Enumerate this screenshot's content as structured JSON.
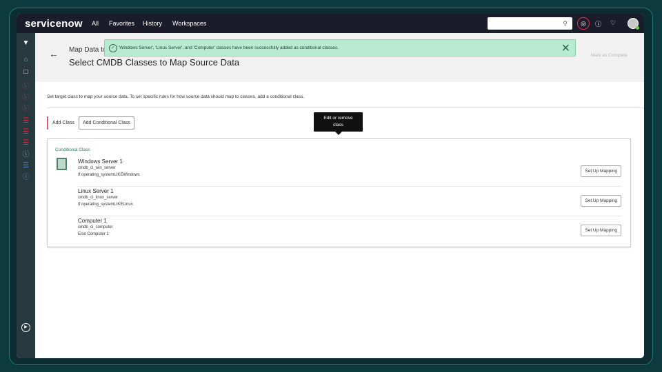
{
  "nav": {
    "logo": "servicenow",
    "items": [
      "All",
      "Favorites",
      "History",
      "Workspaces"
    ],
    "search_placeholder": ""
  },
  "header": {
    "breadcrumb": "Map Data to",
    "title": "Select CMDB Classes to Map Source Data",
    "mark_complete": "Mark as Complete"
  },
  "toast": {
    "message": "'Windows Server', 'Linux Server', and 'Computer' classes have been successfully added as conditional classes."
  },
  "main": {
    "instructions": "Set target class to map your source data. To set specific rules for how source data should map to classes, add a conditional class.",
    "add_class": "Add Class",
    "add_conditional_class": "Add Conditional Class",
    "tooltip_line1": "Edit or remove",
    "tooltip_line2": "class",
    "panel_label": "Conditional Class",
    "setup_label": "Set Up Mapping",
    "rows": [
      {
        "name": "Windows Server 1",
        "table": "cmdb_ci_win_server",
        "condition": "If operating_systemLIKEWindows"
      },
      {
        "name": "Linux Server 1",
        "table": "cmdb_ci_linux_server",
        "condition": "If operating_systemLIKELinux"
      },
      {
        "name": "Computer 1",
        "table": "cmdb_ci_computer",
        "condition": "Else Computer 1"
      }
    ]
  },
  "colors": {
    "nav_bg": "#1b1c2a",
    "sidebar_bg": "#27393c",
    "toast_bg": "#b9ebd3",
    "accent_green": "#2f7d5a",
    "alert_red": "#e0334d"
  }
}
